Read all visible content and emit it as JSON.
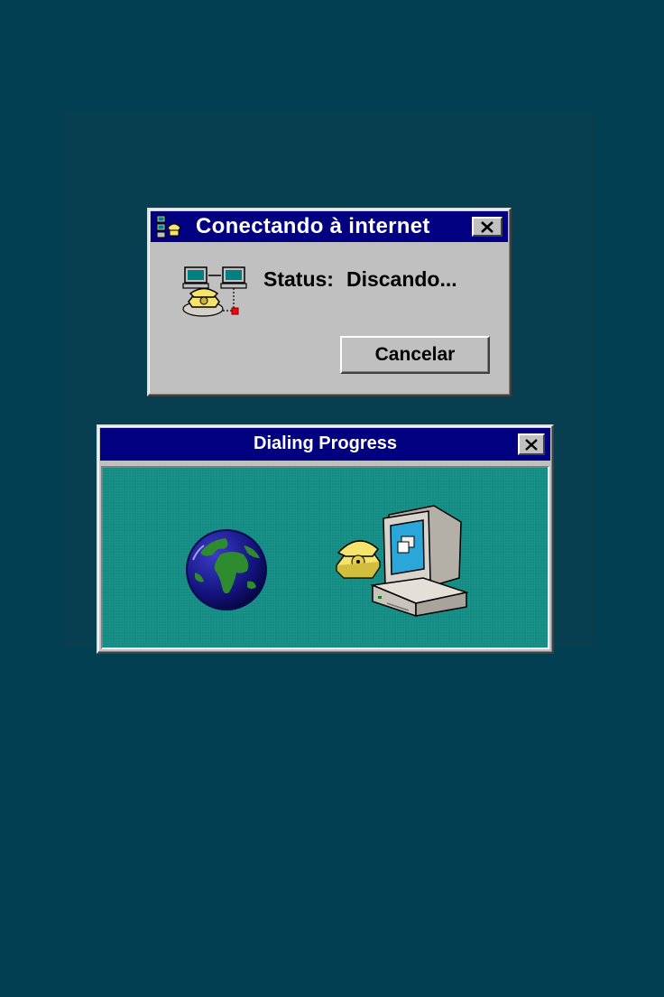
{
  "connect_dialog": {
    "title": "Conectando à internet",
    "status_label": "Status:",
    "status_value": "Discando...",
    "cancel_label": "Cancelar",
    "icons": [
      "dial-up-networking-icon",
      "close-icon",
      "network-connection-icon"
    ]
  },
  "dialing_dialog": {
    "title": "Dialing Progress",
    "icons": [
      "close-icon",
      "globe-icon",
      "computer-phone-icon"
    ]
  },
  "colors": {
    "desktop": "#033f52",
    "titlebar": "#000080",
    "window_face": "#c0c0c0",
    "animation_panel": "#158a82"
  }
}
